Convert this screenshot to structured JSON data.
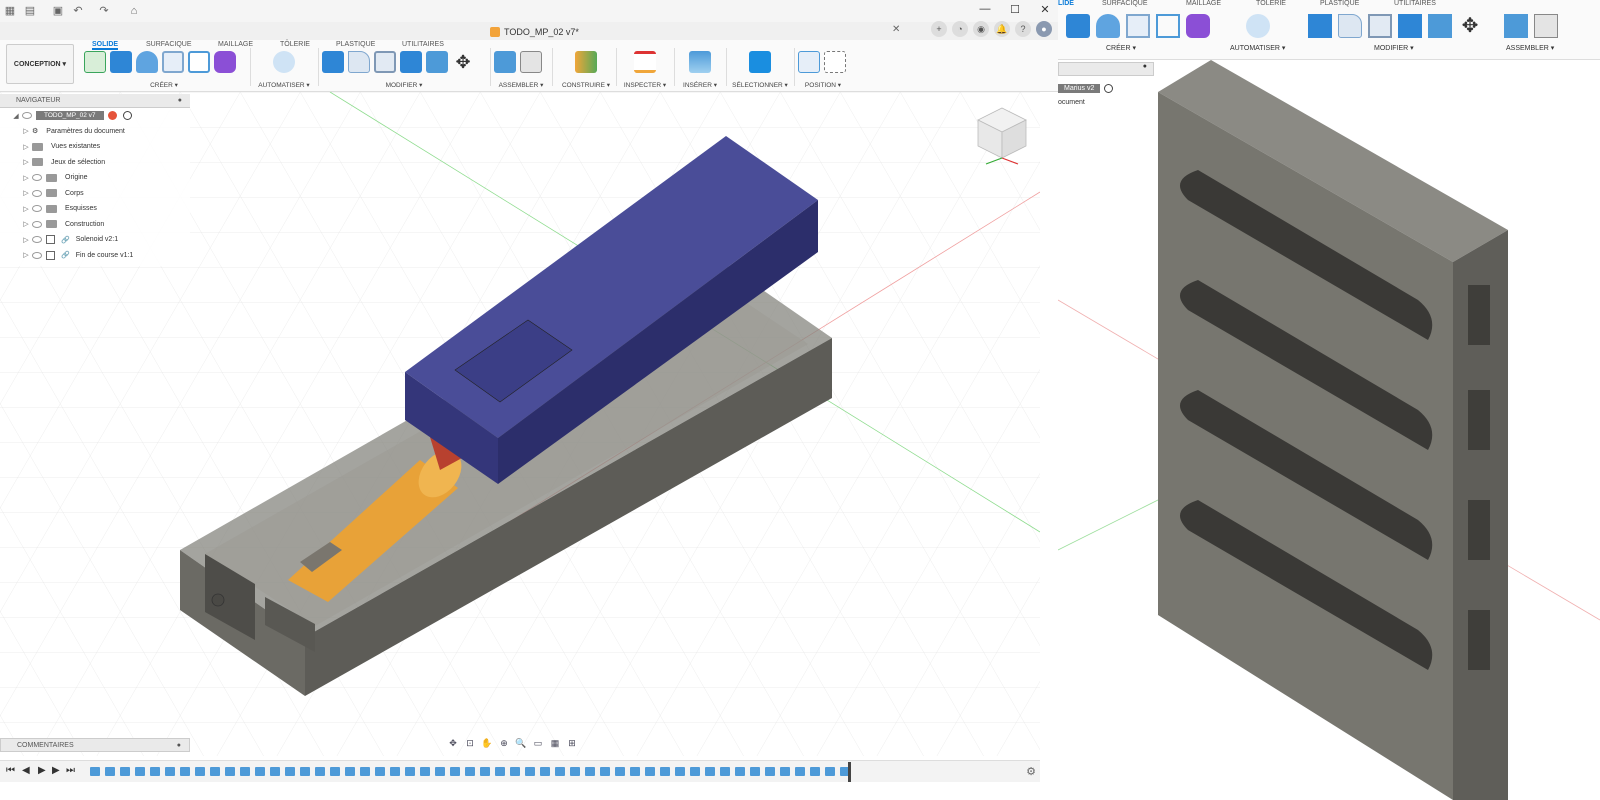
{
  "window": {
    "title": "TODO_MP_02 v7*",
    "controls": {
      "minimize": "—",
      "maximize": "☐",
      "close": "✕"
    }
  },
  "tab_actions": {
    "plus": "+",
    "help": "?"
  },
  "workspace": {
    "button": "CONCEPTION ▾",
    "tabs": [
      "SOLIDE",
      "SURFACIQUE",
      "MAILLAGE",
      "TÔLERIE",
      "PLASTIQUE",
      "UTILITAIRES"
    ],
    "active_tab": "SOLIDE"
  },
  "toolbar_groups": [
    "CRÉER ▾",
    "AUTOMATISER ▾",
    "MODIFIER ▾",
    "ASSEMBLER ▾",
    "CONSTRUIRE ▾",
    "INSPECTER ▾",
    "INSÉRER ▾",
    "SÉLECTIONNER ▾",
    "POSITION ▾"
  ],
  "navigator": {
    "header": "NAVIGATEUR",
    "root": "TODO_MP_02 v7",
    "items": [
      "Paramètres du document",
      "Vues existantes",
      "Jeux de sélection",
      "Origine",
      "Corps",
      "Esquisses",
      "Construction",
      "Solenoid v2:1",
      "Fin de course v1:1"
    ]
  },
  "comments": {
    "label": "COMMENTAIRES"
  },
  "right_panel": {
    "tabs": [
      "SOLIDE",
      "SURFACIQUE",
      "MAILLAGE",
      "TÔLERIE",
      "PLASTIQUE",
      "UTILITAIRES"
    ],
    "groups": [
      "CRÉER ▾",
      "AUTOMATISER ▾",
      "MODIFIER ▾",
      "ASSEMBLER ▾"
    ],
    "nav_item": "Marius v2",
    "nav_sub": "ocument"
  },
  "colors": {
    "accent": "#0b7bd8",
    "body_grey": "#6f6d66",
    "cover_blue": "#3c3f86",
    "solenoid_orange": "#e8a238",
    "grid_red": "#e05a5a",
    "grid_green": "#6ad06a"
  }
}
